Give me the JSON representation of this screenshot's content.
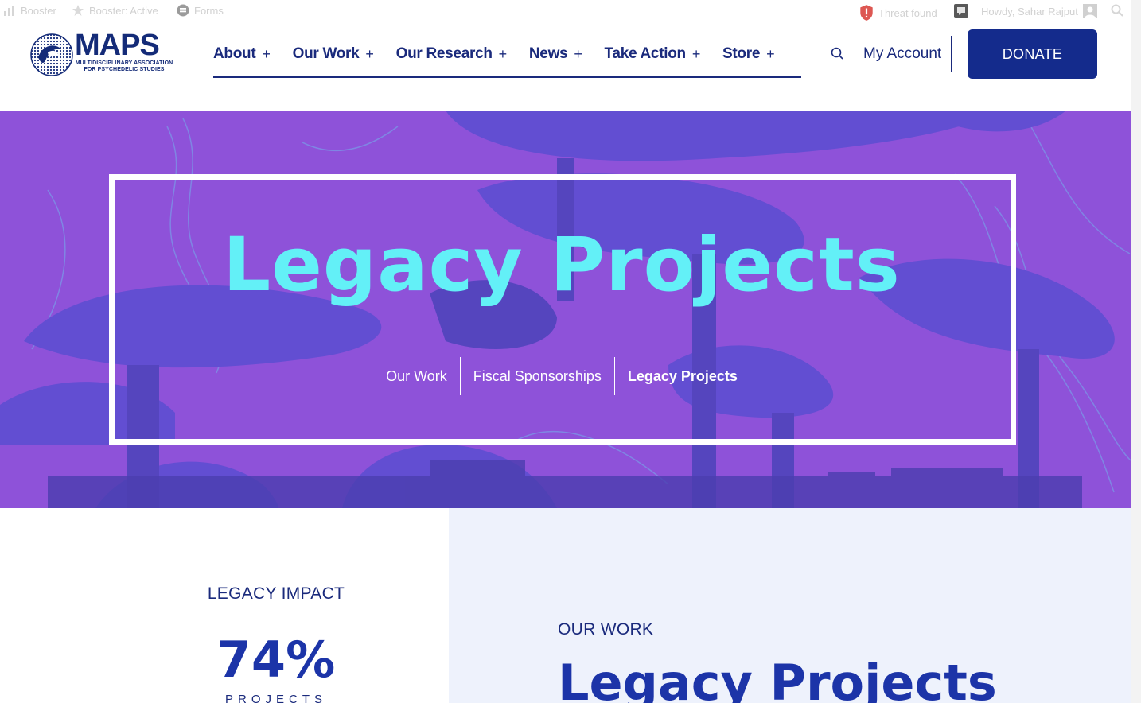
{
  "admin_bar": {
    "booster": "Booster",
    "booster_status": "Booster: Active",
    "forms": "Forms",
    "threat": "Threat found",
    "greeting": "Howdy, Sahar Rajput"
  },
  "header": {
    "logo_word": "MAPS",
    "logo_sub": "MULTIDISCIPLINARY ASSOCIATION FOR PSYCHEDELIC STUDIES",
    "nav": [
      {
        "label": "About",
        "plus": "+"
      },
      {
        "label": "Our Work",
        "plus": "+"
      },
      {
        "label": "Our Research",
        "plus": "+"
      },
      {
        "label": "News",
        "plus": "+"
      },
      {
        "label": "Take Action",
        "plus": "+"
      },
      {
        "label": "Store",
        "plus": "+"
      }
    ],
    "account": "My Account",
    "donate": "DONATE"
  },
  "hero": {
    "title": "Legacy Projects",
    "breadcrumbs": [
      "Our Work",
      "Fiscal Sponsorships",
      "Legacy Projects"
    ]
  },
  "impact": {
    "label": "LEGACY IMPACT",
    "value": "74%",
    "sub": "PROJECTS"
  },
  "our_work": {
    "label": "OUR WORK",
    "title": "Legacy Projects"
  },
  "colors": {
    "brand_navy": "#1a2a7c",
    "donate_bg": "#142b8c",
    "hero_purple": "#8c4fd6",
    "hero_title": "#63f0f7",
    "panel_bg": "#eef2fc"
  },
  "icons": {
    "search": "search-icon",
    "threat": "shield-alert-icon",
    "logo_mark": "globe-logo-icon"
  }
}
